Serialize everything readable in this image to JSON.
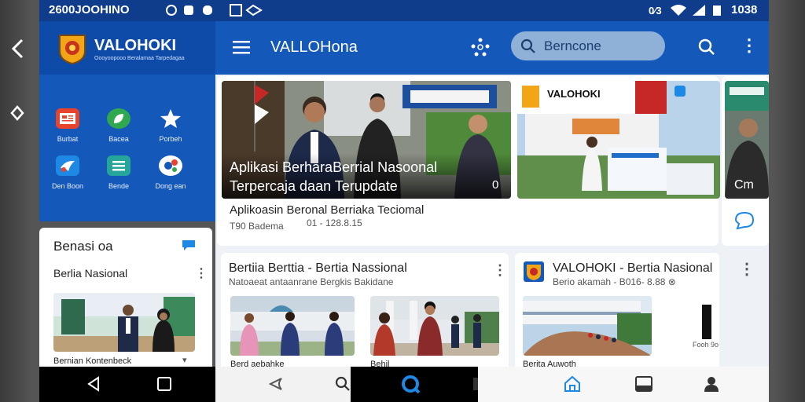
{
  "status_bar": {
    "left_text": "2600JOOHINO",
    "time": "1038"
  },
  "app": {
    "brand": "VALOHOKI",
    "brand_tagline": "Oooyoopooo Beralamaa Tarpedagaa",
    "toolbar_title": "VALLOHona"
  },
  "search": {
    "value": "Berncone"
  },
  "sidebar_grid": [
    {
      "label": "Burbat",
      "icon": "news-icon",
      "color": "#e8432d"
    },
    {
      "label": "Bacea",
      "icon": "leaf-icon",
      "color": "#2fa84f"
    },
    {
      "label": "Porbeh",
      "icon": "star-icon",
      "color": "#ffffff"
    },
    {
      "label": "Den Boon",
      "icon": "bird-icon",
      "color": "#1e88e5"
    },
    {
      "label": "Bende",
      "icon": "list-icon",
      "color": "#26a69a"
    },
    {
      "label": "Dong ean",
      "icon": "social-icon",
      "color": "#ffffff"
    }
  ],
  "left_card": {
    "heading": "Benasi oa",
    "subheading": "Berlia Nasional",
    "caption": "Bernian Kontenbeck"
  },
  "featured": {
    "overlay_line1": "Aplikasi BerharaBerrial Nasoonal",
    "overlay_line2": "Terpercaja daan Terupdate",
    "overlay_badge": "0",
    "caption": "Aplikoasin Beronal Berriaka Teciomal",
    "meta": "T90 Badema",
    "meta_date": "01 - 128.8.15"
  },
  "side_tile": {
    "brand": "VALOHOKI",
    "partial_text": "Cm"
  },
  "cards": [
    {
      "title": "Bertiia Berttia - Bertia Nassional",
      "subtitle": "Natoaeat antaanrane Bergkis Bakidane",
      "captions": [
        "Berd aebahke",
        "Behil"
      ]
    },
    {
      "title": "VALOHOKI - Bertia Nasional",
      "subtitle": "Berio akamah - B016- 8.88 ⊗",
      "captions": [
        "Berita Auwoth",
        "Fooh 9o"
      ]
    }
  ]
}
